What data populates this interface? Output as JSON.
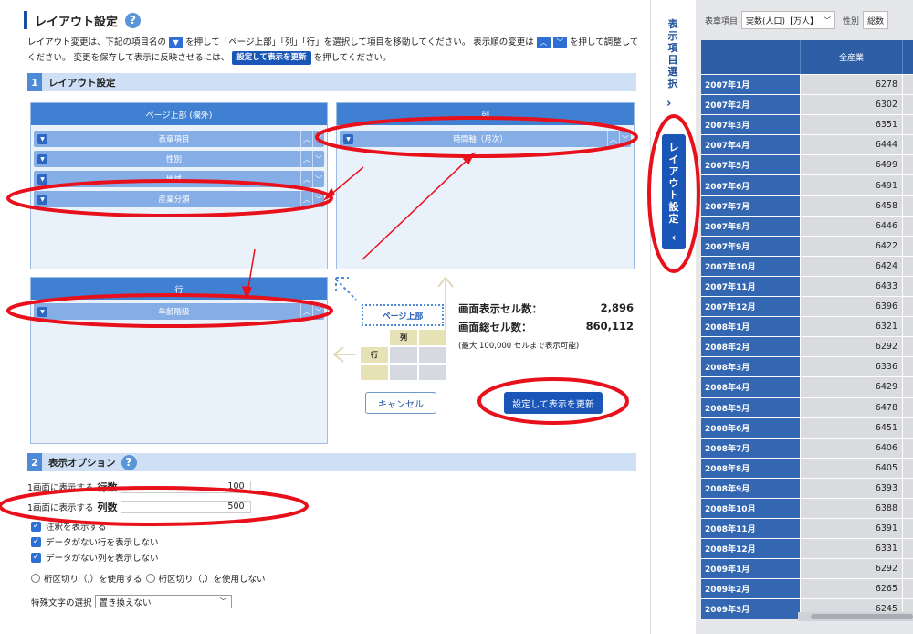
{
  "title": "レイアウト設定",
  "help_icon": "?",
  "instructions": {
    "p1": "レイアウト変更は、下記の項目名の",
    "p2": "を押して「ページ上部」「列」「行」を選択して項目を移動してください。 表示順の変更は",
    "p3": "を押して調整してください。 変更を保存して表示に反映させるには、",
    "update_chip": "設定して表示を更新",
    "p4": "を押してください。"
  },
  "section1": {
    "num": "1",
    "label": "レイアウト設定"
  },
  "page_top_box": {
    "header": "ページ上部 (欄外)",
    "items": [
      "表章項目",
      "性別",
      "地域",
      "産業分類"
    ]
  },
  "column_box": {
    "header": "列",
    "items": [
      "時間軸（月次）"
    ]
  },
  "row_box": {
    "header": "行",
    "items": [
      "年齢階級"
    ]
  },
  "diagram": {
    "page_top": "ページ上部",
    "col": "列",
    "row": "行"
  },
  "stats": {
    "display_label": "画面表示セル数：",
    "display_value": "2,896",
    "total_label": "画面総セル数：",
    "total_value": "860,112",
    "note": "(最大 100,000 セルまで表示可能)"
  },
  "buttons": {
    "cancel": "キャンセル",
    "update": "設定して表示を更新"
  },
  "section2": {
    "num": "2",
    "label": "表示オプション"
  },
  "options": {
    "rows_prefix": "1画面に表示する",
    "rows_label": "行数",
    "rows_value": "100",
    "cols_prefix": "1画面に表示する",
    "cols_label": "列数",
    "cols_value": "500",
    "check1": "注釈を表示する",
    "check2": "データがない行を表示しない",
    "check3": "データがない列を表示しない",
    "radio1": "桁区切り（,）を使用する",
    "radio2": "桁区切り（,）を使用しない",
    "special_label": "特殊文字の選択",
    "special_value": "置き換えない"
  },
  "side": {
    "select_tab": "表示項目選択",
    "layout_tab": "レイアウト設定"
  },
  "filter": {
    "label1": "表章項目",
    "value1": "実数(人口)【万人】",
    "label2": "性別",
    "label3": "総数"
  },
  "table": {
    "column": "全産業",
    "rows": [
      {
        "label": "2007年1月",
        "value": "6278"
      },
      {
        "label": "2007年2月",
        "value": "6302"
      },
      {
        "label": "2007年3月",
        "value": "6351"
      },
      {
        "label": "2007年4月",
        "value": "6444"
      },
      {
        "label": "2007年5月",
        "value": "6499"
      },
      {
        "label": "2007年6月",
        "value": "6491"
      },
      {
        "label": "2007年7月",
        "value": "6458"
      },
      {
        "label": "2007年8月",
        "value": "6446"
      },
      {
        "label": "2007年9月",
        "value": "6422"
      },
      {
        "label": "2007年10月",
        "value": "6424"
      },
      {
        "label": "2007年11月",
        "value": "6433"
      },
      {
        "label": "2007年12月",
        "value": "6396"
      },
      {
        "label": "2008年1月",
        "value": "6321"
      },
      {
        "label": "2008年2月",
        "value": "6292"
      },
      {
        "label": "2008年3月",
        "value": "6336"
      },
      {
        "label": "2008年4月",
        "value": "6429"
      },
      {
        "label": "2008年5月",
        "value": "6478"
      },
      {
        "label": "2008年6月",
        "value": "6451"
      },
      {
        "label": "2008年7月",
        "value": "6406"
      },
      {
        "label": "2008年8月",
        "value": "6405"
      },
      {
        "label": "2008年9月",
        "value": "6393"
      },
      {
        "label": "2008年10月",
        "value": "6388"
      },
      {
        "label": "2008年11月",
        "value": "6391"
      },
      {
        "label": "2008年12月",
        "value": "6331"
      },
      {
        "label": "2009年1月",
        "value": "6292"
      },
      {
        "label": "2009年2月",
        "value": "6265"
      },
      {
        "label": "2009年3月",
        "value": "6245"
      }
    ]
  },
  "colors": {
    "accent": "#1a56b8",
    "annotation": "#e8101a",
    "table_header": "#3467b1"
  }
}
